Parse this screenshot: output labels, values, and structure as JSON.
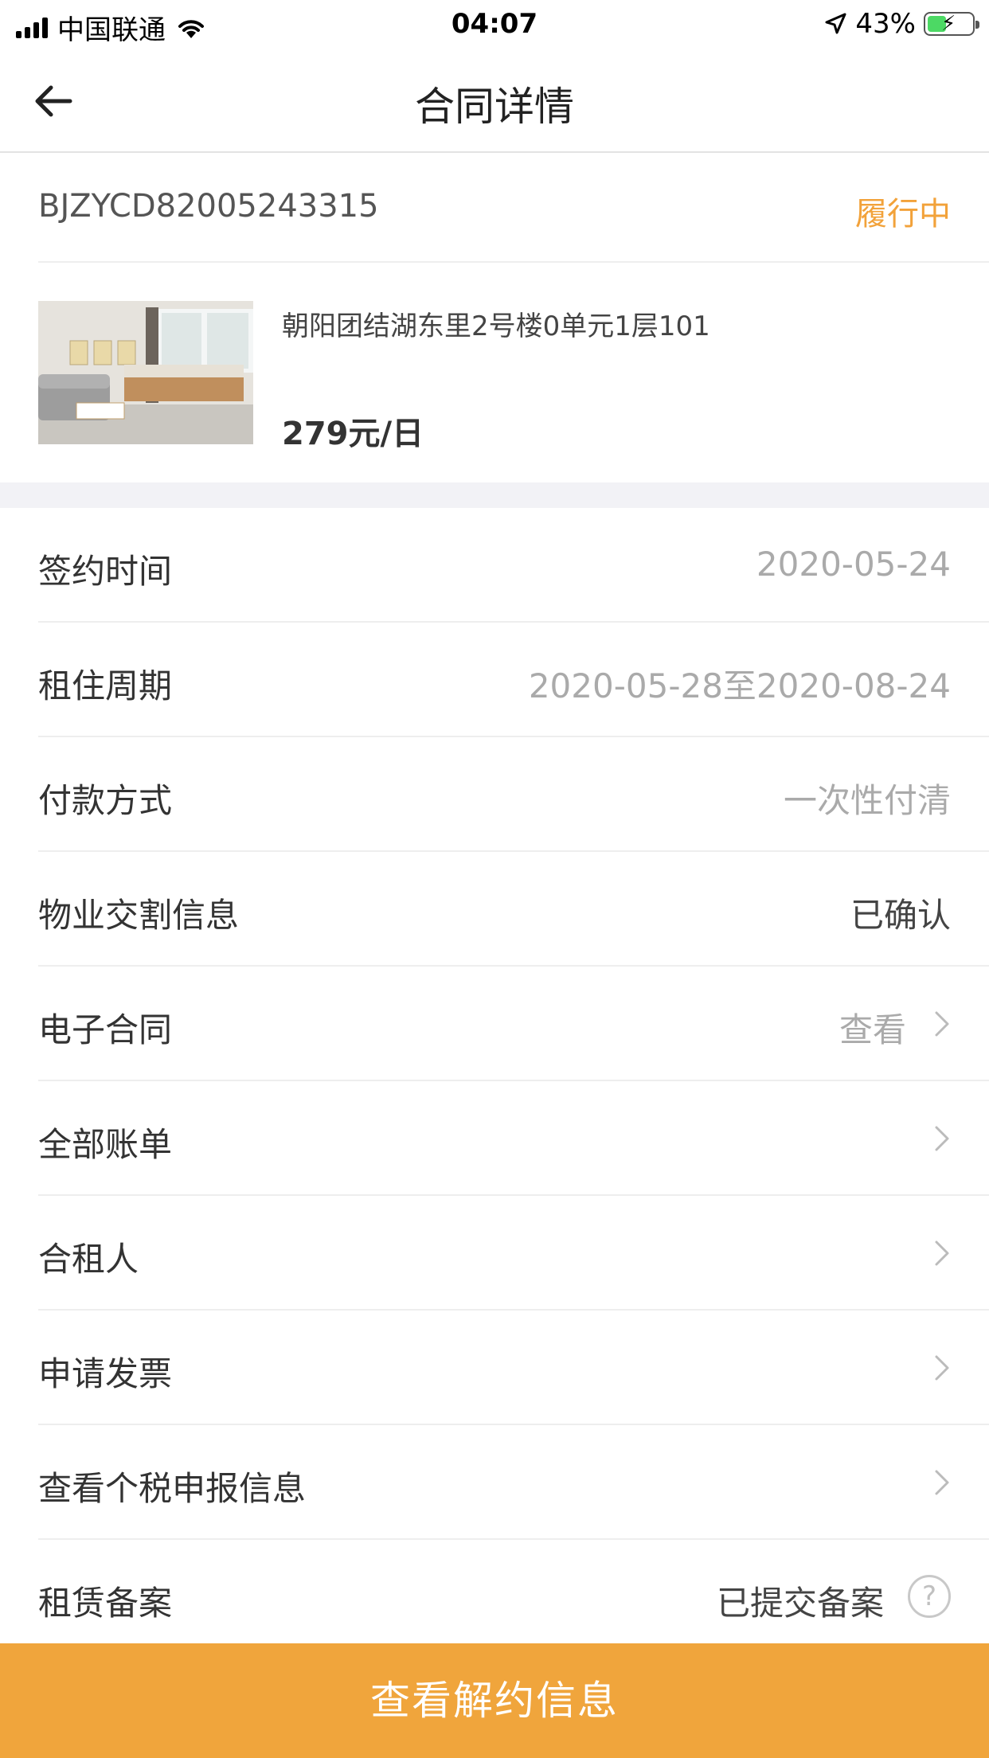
{
  "status_bar": {
    "carrier": "中国联通",
    "time": "04:07",
    "battery": "43%",
    "battery_level": 0.43
  },
  "nav": {
    "title": "合同详情"
  },
  "contract": {
    "number": "BJZYCD82005243315",
    "status": "履行中",
    "status_color": "#f2a23a"
  },
  "house": {
    "address": "朝阳团结湖东里2号楼0单元1层101",
    "price": "279元/日"
  },
  "rows": [
    {
      "label": "签约时间",
      "value": "2020-05-24"
    },
    {
      "label": "租住周期",
      "value": "2020-05-28至2020-08-24"
    },
    {
      "label": "付款方式",
      "value": "一次性付清"
    },
    {
      "label": "物业交割信息",
      "value": "已确认"
    },
    {
      "label": "电子合同",
      "value": "查看"
    },
    {
      "label": "全部账单",
      "value": ""
    },
    {
      "label": "合租人",
      "value": ""
    },
    {
      "label": "申请发票",
      "value": ""
    },
    {
      "label": "查看个税申报信息",
      "value": ""
    },
    {
      "label": "租赁备案",
      "value": "已提交备案"
    }
  ],
  "bottom_button": {
    "label": "查看解约信息",
    "color": "#f0a53c"
  },
  "icons": {
    "back": "back-arrow-icon",
    "chevron": "chevron-right-icon",
    "help": "question-circle-icon"
  }
}
